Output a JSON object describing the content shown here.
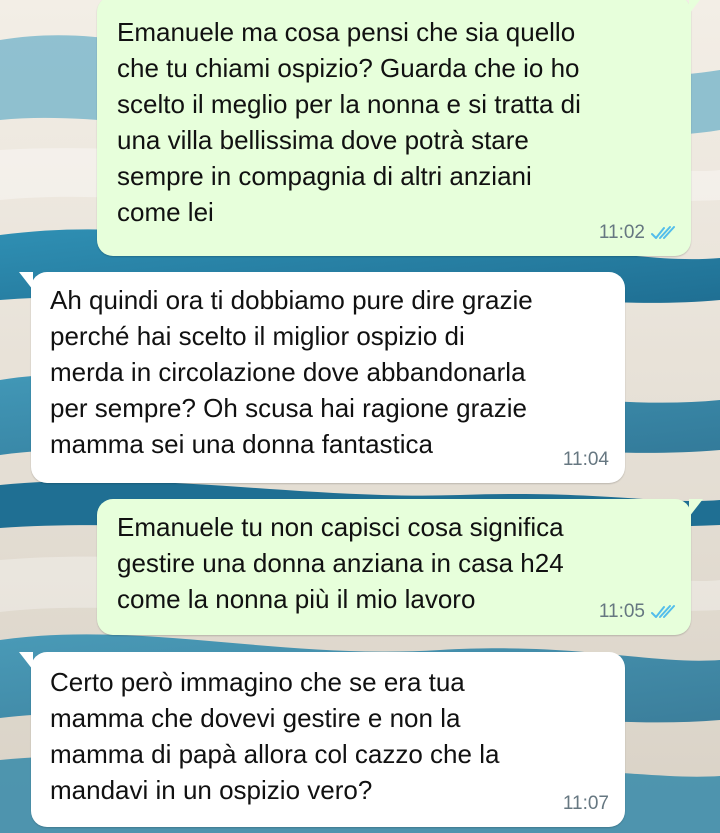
{
  "chat": {
    "messages": [
      {
        "direction": "outgoing",
        "text": "Emanuele ma cosa pensi che sia quello\nche tu chiami ospizio? Guarda che io ho\nscelto il meglio per la nonna e si tratta di\nuna villa bellissima dove potrà stare\nsempre in compagnia di altri anziani\ncome lei",
        "time": "11:02",
        "status_icon": "double-check-read-icon"
      },
      {
        "direction": "incoming",
        "text": "Ah quindi ora ti dobbiamo pure dire grazie\nperché hai scelto il miglior ospizio di\nmerda in circolazione dove abbandonarla\nper sempre? Oh scusa hai ragione grazie\nmamma sei una donna fantastica",
        "time": "11:04"
      },
      {
        "direction": "outgoing",
        "text": "Emanuele tu non capisci cosa significa\ngestire una donna anziana in casa h24\ncome la nonna più il mio lavoro",
        "time": "11:05",
        "status_icon": "double-check-read-icon"
      },
      {
        "direction": "incoming",
        "text": "Certo però immagino che se era tua\nmamma che dovevi gestire e non la\nmamma di papà allora col cazzo che la\nmandavi in un ospizio vero?",
        "time": "11:07"
      }
    ]
  },
  "colors": {
    "outgoing_bubble": "#e7ffdb",
    "incoming_bubble": "#ffffff",
    "read_ticks": "#53bdeb",
    "timestamp": "#667781"
  }
}
